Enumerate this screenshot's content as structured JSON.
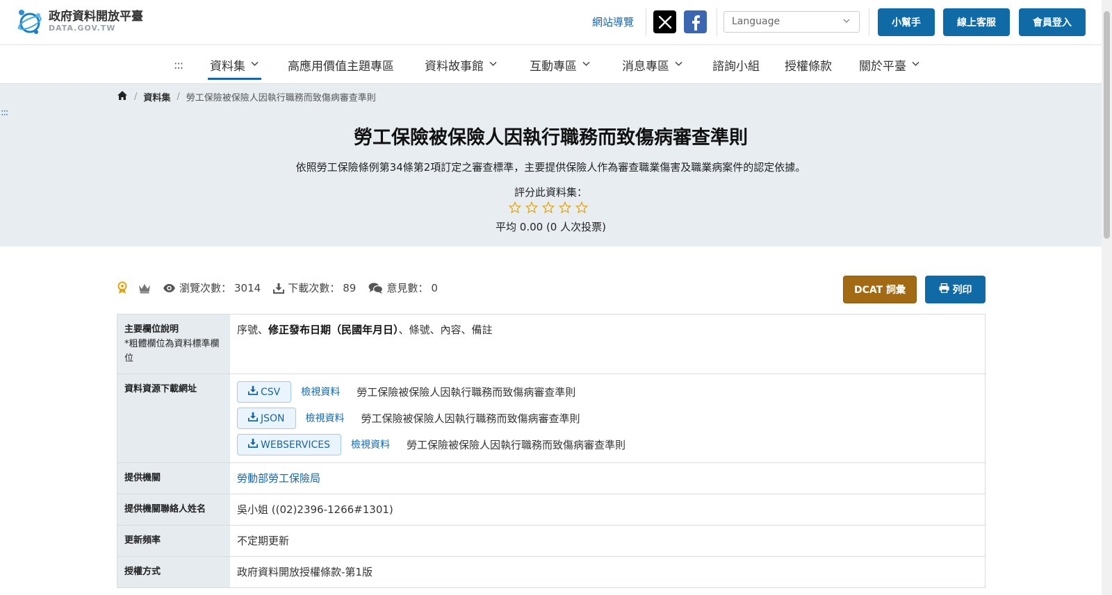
{
  "header": {
    "logo_zh": "政府資料開放平臺",
    "logo_en": "DATA.GOV.TW",
    "sitemap_label": "網站導覽",
    "language_placeholder": "Language",
    "helper_button": "小幫手",
    "service_button": "線上客服",
    "login_button": "會員登入"
  },
  "nav": {
    "dots": ":::",
    "items": [
      {
        "label": "資料集",
        "dropdown": true,
        "active": true
      },
      {
        "label": "高應用價值主題專區",
        "dropdown": false
      },
      {
        "label": "資料故事館",
        "dropdown": true
      },
      {
        "label": "互動專區",
        "dropdown": true
      },
      {
        "label": "消息專區",
        "dropdown": true
      },
      {
        "label": "諮詢小組",
        "dropdown": false
      },
      {
        "label": "授權條款",
        "dropdown": false
      },
      {
        "label": "關於平臺",
        "dropdown": true
      }
    ]
  },
  "breadcrumb": {
    "section": "資料集",
    "current": "勞工保險被保險人因執行職務而致傷病審查準則"
  },
  "skip_dots": ":::",
  "dataset": {
    "title": "勞工保險被保險人因執行職務而致傷病審查準則",
    "description": "依照勞工保險條例第34條第2項訂定之審查標準，主要提供保險人作為審查職業傷害及職業病案件的認定依據。",
    "rating_label": "評分此資料集：",
    "rating_value": 0,
    "rating_max": 5,
    "rating_average": "平均 0.00 (0 人次投票)"
  },
  "stats": {
    "views_label": "瀏覽次數：",
    "views": "3014",
    "downloads_label": "下載次數：",
    "downloads": "89",
    "comments_label": "意見數：",
    "comments": "0"
  },
  "actions": {
    "dcat": "DCAT 詞彙",
    "print": "列印"
  },
  "info": {
    "fields": {
      "label": "主要欄位說明",
      "sub": "*粗體欄位為資料標準欄位",
      "pre": "序號、",
      "bold": "修正發布日期（民國年月日）",
      "post": "、條號、內容、備註"
    },
    "resources": {
      "label": "資料資源下載網址",
      "items": [
        {
          "format": "CSV",
          "view": "檢視資料",
          "name": "勞工保險被保險人因執行職務而致傷病審查準則"
        },
        {
          "format": "JSON",
          "view": "檢視資料",
          "name": "勞工保險被保險人因執行職務而致傷病審查準則"
        },
        {
          "format": "WEBSERVICES",
          "view": "檢視資料",
          "name": "勞工保險被保險人因執行職務而致傷病審查準則"
        }
      ]
    },
    "provider": {
      "label": "提供機關",
      "value": "勞動部勞工保險局"
    },
    "contact": {
      "label": "提供機關聯絡人姓名",
      "value": "吳小姐 ((02)2396-1266#1301)"
    },
    "frequency": {
      "label": "更新頻率",
      "value": "不定期更新"
    },
    "license": {
      "label": "授權方式",
      "value": "政府資料開放授權條款-第1版"
    }
  },
  "colors": {
    "primary": "#0f6aa6",
    "dcat": "#a36a14",
    "hero_bg": "#e8edf2",
    "star": "#e0a514"
  }
}
